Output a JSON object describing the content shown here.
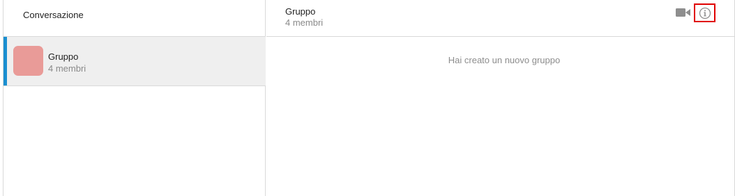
{
  "sidebar": {
    "title": "Conversazione",
    "conversations": [
      {
        "name": "Gruppo",
        "members": "4 membri",
        "avatar_color": "#e99b98",
        "selected": true
      }
    ]
  },
  "chat": {
    "header": {
      "title": "Gruppo",
      "subtitle": "4 membri"
    },
    "actions": {
      "video_icon": "video-camera-icon",
      "info_icon": "info-icon"
    },
    "system_message": "Hai creato un nuovo gruppo"
  },
  "colors": {
    "accent": "#1a8fd0",
    "highlight_border": "#e00000",
    "selected_bg": "#efefef"
  }
}
